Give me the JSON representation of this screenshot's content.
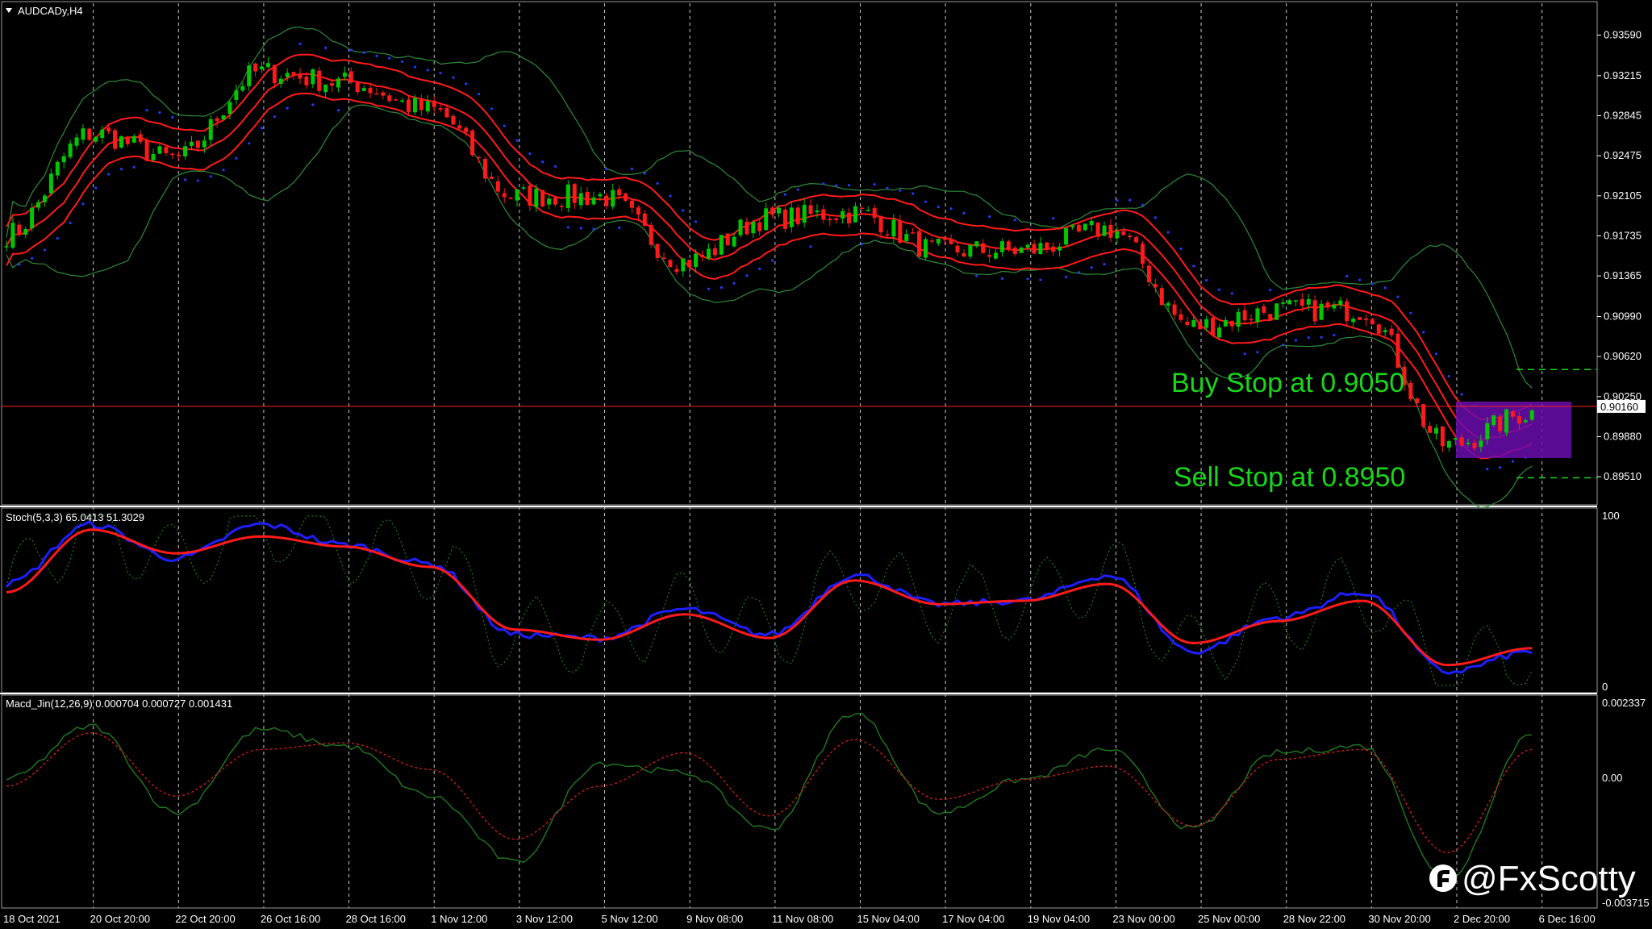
{
  "window": {
    "symbol_title": "AUDCADy,H4",
    "title_arrow_icon": "triangle-down-icon"
  },
  "colors": {
    "background": "#000000",
    "bull_candle": "#00c800",
    "bear_candle": "#ff1a1a",
    "envelope": "#ff1a1a",
    "bollinger": "#2e8b3a",
    "psar": "#1e3cff",
    "stoch_main": "#1e1eff",
    "stoch_signal": "#ff1a1a",
    "macd_line": "#1f7a1f",
    "macd_signal": "#cc1a1a",
    "highlight_box": "#6a0dad",
    "annotation_text": "#19d619",
    "grid": "#c8c8c8"
  },
  "price_panel": {
    "y_ticks": [
      "0.93590",
      "0.93215",
      "0.92845",
      "0.92475",
      "0.92105",
      "0.91735",
      "0.91365",
      "0.90990",
      "0.90620",
      "0.90250",
      "0.89880",
      "0.89510"
    ],
    "current_price": "0.90160",
    "buy_stop_text": "Buy Stop at 0.9050",
    "sell_stop_text": "Sell Stop at 0.8950"
  },
  "stoch_panel": {
    "title": "Stoch(5,3,3) 65.0413 51.3029",
    "y_ticks": [
      "100",
      "0"
    ]
  },
  "macd_panel": {
    "title": "Macd_Jin(12,26,9) 0.000704 0.000727 0.001431",
    "y_ticks": [
      "0.002337",
      "0.00",
      "-0.003715"
    ]
  },
  "x_axis": {
    "labels": [
      "18 Oct 2021",
      "20 Oct 20:00",
      "22 Oct 20:00",
      "26 Oct 16:00",
      "28 Oct 16:00",
      "1 Nov 12:00",
      "3 Nov 12:00",
      "5 Nov 12:00",
      "9 Nov 08:00",
      "11 Nov 08:00",
      "15 Nov 04:00",
      "17 Nov 04:00",
      "19 Nov 04:00",
      "23 Nov 00:00",
      "25 Nov 00:00",
      "28 Nov 22:00",
      "30 Nov 20:00",
      "2 Dec 20:00",
      "6 Dec 16:00"
    ]
  },
  "watermark": {
    "icon": "brand-logo-icon",
    "handle": "@FxScotty"
  },
  "chart_data": {
    "type": "line",
    "x": [
      "18 Oct 2021",
      "20 Oct 20:00",
      "22 Oct 20:00",
      "26 Oct 16:00",
      "28 Oct 16:00",
      "1 Nov 12:00",
      "3 Nov 12:00",
      "5 Nov 12:00",
      "9 Nov 08:00",
      "11 Nov 08:00",
      "15 Nov 04:00",
      "17 Nov 04:00",
      "19 Nov 04:00",
      "23 Nov 00:00",
      "25 Nov 00:00",
      "28 Nov 22:00",
      "30 Nov 20:00",
      "2 Dec 20:00",
      "6 Dec 16:00"
    ],
    "price": {
      "ylim": [
        0.8931,
        0.9378
      ],
      "close": [
        0.9175,
        0.9268,
        0.9245,
        0.9325,
        0.9315,
        0.929,
        0.921,
        0.921,
        0.915,
        0.919,
        0.9195,
        0.916,
        0.916,
        0.918,
        0.909,
        0.9105,
        0.9105,
        0.898,
        0.901
      ],
      "levels": {
        "current_price": 0.9016,
        "buy_stop": 0.905,
        "sell_stop": 0.895
      }
    },
    "stochastic": {
      "ylim": [
        0,
        100
      ],
      "main": [
        60,
        95,
        75,
        95,
        83,
        72,
        30,
        28,
        45,
        30,
        65,
        48,
        50,
        65,
        20,
        40,
        55,
        8,
        20
      ],
      "signal": [
        55,
        92,
        78,
        88,
        82,
        70,
        33,
        27,
        42,
        28,
        62,
        48,
        50,
        60,
        25,
        38,
        50,
        12,
        22
      ]
    },
    "macd": {
      "ylim": [
        -0.003715,
        0.002337
      ],
      "main": [
        0.0,
        0.0016,
        -0.001,
        0.0015,
        0.001,
        -0.0005,
        -0.0025,
        0.0005,
        0.0002,
        -0.0015,
        0.002,
        -0.001,
        0.0,
        0.0009,
        -0.0015,
        0.0008,
        0.001,
        -0.003,
        0.0014
      ],
      "signal": [
        -0.0002,
        0.0014,
        -0.0005,
        0.0009,
        0.0011,
        0.0003,
        -0.0018,
        -0.0002,
        0.0008,
        -0.0011,
        0.0012,
        -0.0006,
        0.0,
        0.0004,
        -0.0014,
        0.0006,
        0.0009,
        -0.0022,
        0.0009
      ]
    }
  }
}
